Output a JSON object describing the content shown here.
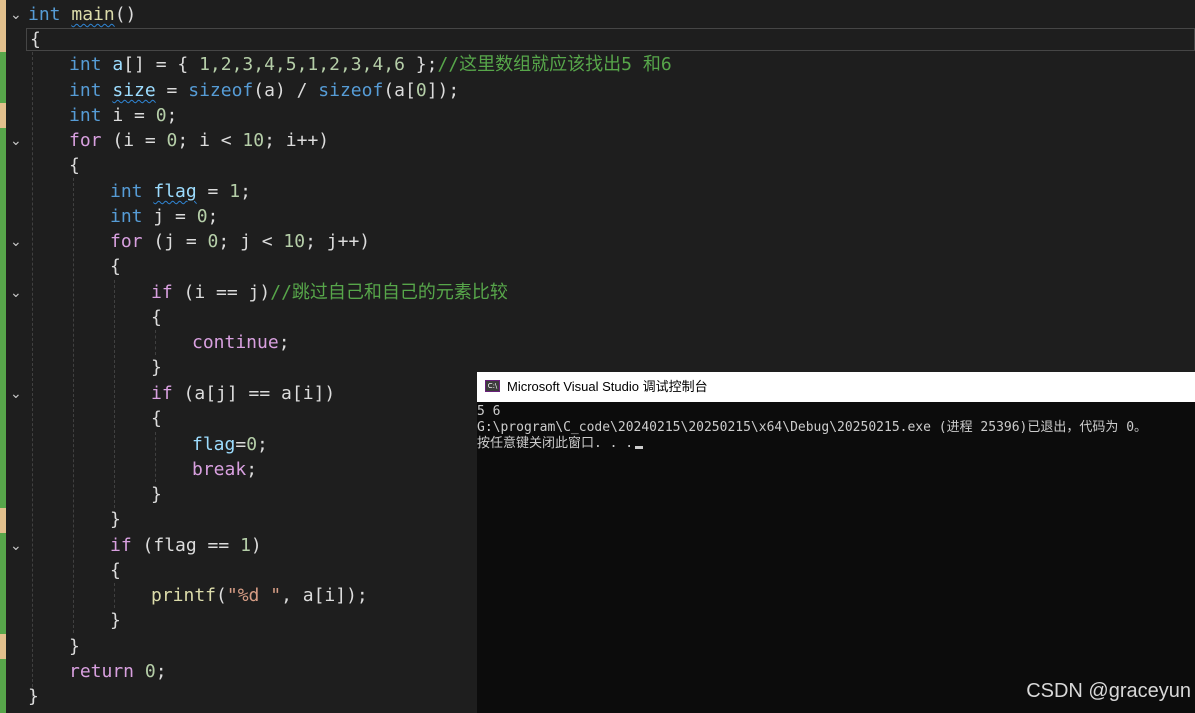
{
  "code": {
    "l1_type": "int",
    "l1_name": "main",
    "l1_paren": "()",
    "l2": "{",
    "l3_type": "int",
    "l3_var": "a",
    "l3_decl": "[] = { ",
    "l3_vals": "1,2,3,4,5,1,2,3,4,6",
    "l3_end": " };",
    "l3_comment": "//这里数组就应该找出5 和6",
    "l4_type": "int",
    "l4_var": "size",
    "l4_eq": " = ",
    "l4_sizeof1": "sizeof",
    "l4_a1": "(a) / ",
    "l4_sizeof2": "sizeof",
    "l4_a2": "(a[",
    "l4_zero": "0",
    "l4_end": "]);",
    "l5_type": "int",
    "l5_rest": " i = ",
    "l5_zero": "0",
    "l5_semi": ";",
    "l6_for": "for",
    "l6_a": " (i = ",
    "l6_n0": "0",
    "l6_b": "; i < ",
    "l6_n10": "10",
    "l6_c": "; i++)",
    "l7": "{",
    "l8_type": "int",
    "l8_var": "flag",
    "l8_eq": " = ",
    "l8_one": "1",
    "l8_semi": ";",
    "l9_type": "int",
    "l9_rest": " j = ",
    "l9_zero": "0",
    "l9_semi": ";",
    "l10_for": "for",
    "l10_a": " (j = ",
    "l10_n0": "0",
    "l10_b": "; j < ",
    "l10_n10": "10",
    "l10_c": "; j++)",
    "l11": "{",
    "l12_if": "if",
    "l12_rest": " (i == j)",
    "l12_comment": "//跳过自己和自己的元素比较",
    "l13": "{",
    "l14_kw": "continue",
    "l14_semi": ";",
    "l15": "}",
    "l16_if": "if",
    "l16_rest": " (a[j] == a[i])",
    "l17": "{",
    "l18_var": "flag",
    "l18_eq": "=",
    "l18_zero": "0",
    "l18_semi": ";",
    "l19_kw": "break",
    "l19_semi": ";",
    "l20": "}",
    "l21": "}",
    "l22_if": "if",
    "l22_a": " (flag == ",
    "l22_one": "1",
    "l22_b": ")",
    "l23": "{",
    "l24_fn": "printf",
    "l24_open": "(",
    "l24_str": "\"%d \"",
    "l24_rest": ", a[i]);",
    "l25": "}",
    "l26": "}",
    "l27_kw": "return",
    "l27_sp": " ",
    "l27_zero": "0",
    "l27_semi": ";",
    "l28": "}"
  },
  "console": {
    "title": "Microsoft Visual Studio 调试控制台",
    "icon_label": "C:\\",
    "line1": "5 6",
    "line2": "G:\\program\\C_code\\20240215\\20250215\\x64\\Debug\\20250215.exe (进程 25396)已退出，代码为 0。",
    "line3": "按任意键关闭此窗口. . ."
  },
  "watermark": "CSDN @graceyun",
  "icons": {
    "fold": "chevron-down-icon",
    "console_icon": "console-app-icon"
  },
  "colors": {
    "keyword": "#569cd6",
    "comment": "#57a64a",
    "number": "#b5cea8",
    "string": "#d69d85",
    "function": "#dcdcaa"
  }
}
